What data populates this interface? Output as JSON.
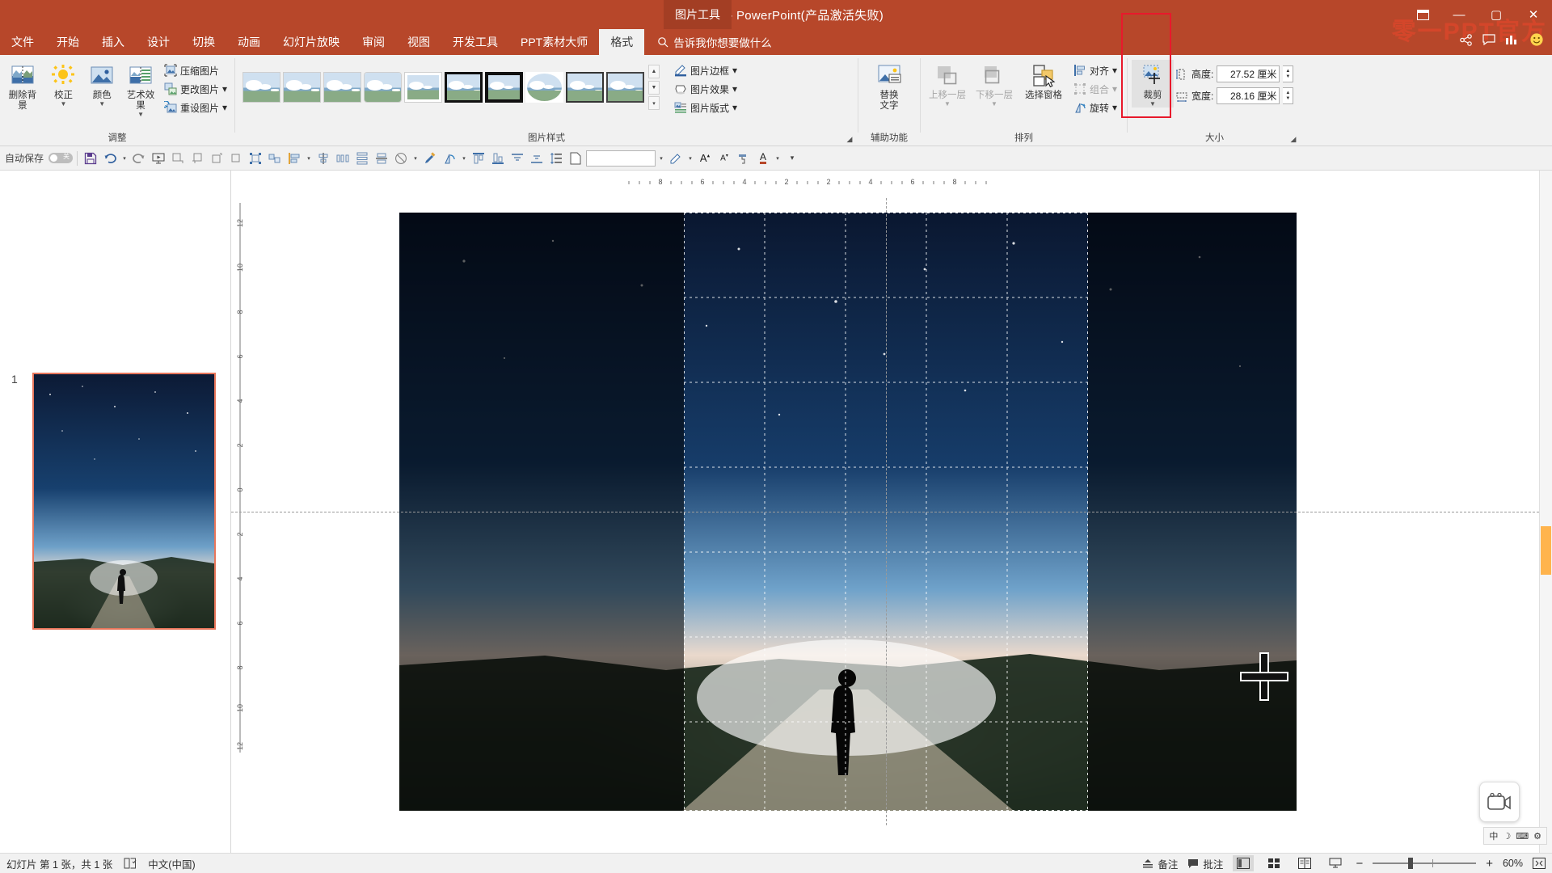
{
  "titlebar": {
    "title": "演示文稿1  -  PowerPoint(产品激活失败)",
    "context_tab": "图片工具",
    "ribbon_display_icon": "ribbon-display-icon",
    "minimize": "—",
    "maximize": "▢",
    "close": "✕"
  },
  "tabs": [
    {
      "label": "文件",
      "active": false
    },
    {
      "label": "开始",
      "active": false
    },
    {
      "label": "插入",
      "active": false
    },
    {
      "label": "设计",
      "active": false
    },
    {
      "label": "切换",
      "active": false
    },
    {
      "label": "动画",
      "active": false
    },
    {
      "label": "幻灯片放映",
      "active": false
    },
    {
      "label": "审阅",
      "active": false
    },
    {
      "label": "视图",
      "active": false
    },
    {
      "label": "开发工具",
      "active": false
    },
    {
      "label": "PPT素材大师",
      "active": false
    },
    {
      "label": "格式",
      "active": true
    }
  ],
  "tellme": {
    "text": "告诉我你想要做什么",
    "icon": "search-icon"
  },
  "watermark": "零一PPT官方",
  "ribbon": {
    "groups": [
      {
        "title": "调整",
        "big_buttons": [
          {
            "label": "删除背景",
            "icon": "remove-background-icon",
            "caret": false
          },
          {
            "label": "校正",
            "icon": "corrections-icon",
            "caret": true
          },
          {
            "label": "颜色",
            "icon": "color-icon",
            "caret": true
          },
          {
            "label": "艺术效果",
            "icon": "artistic-effects-icon",
            "caret": true
          }
        ],
        "small_buttons": [
          {
            "label": "压缩图片",
            "icon": "compress-picture-icon"
          },
          {
            "label": "更改图片",
            "icon": "change-picture-icon",
            "caret": true
          },
          {
            "label": "重设图片",
            "icon": "reset-picture-icon",
            "caret": true
          }
        ]
      },
      {
        "title": "图片样式",
        "styles_count": 10,
        "selected_index": 5,
        "scroll_up": "▲",
        "scroll_down": "▼",
        "scroll_more": "▾",
        "side_buttons": [
          {
            "label": "图片边框",
            "icon": "picture-border-icon"
          },
          {
            "label": "图片效果",
            "icon": "picture-effects-icon"
          },
          {
            "label": "图片版式",
            "icon": "picture-layout-icon"
          }
        ]
      },
      {
        "title": "辅助功能",
        "big_buttons": [
          {
            "label": "替换\n文字",
            "icon": "alt-text-icon"
          }
        ]
      },
      {
        "title": "排列",
        "big_buttons": [
          {
            "label": "上移一层",
            "icon": "bring-forward-icon",
            "caret": true,
            "disabled": true
          },
          {
            "label": "下移一层",
            "icon": "send-backward-icon",
            "caret": true,
            "disabled": true
          },
          {
            "label": "选择窗格",
            "icon": "selection-pane-icon",
            "caret": false
          }
        ],
        "small_buttons": [
          {
            "label": "对齐",
            "icon": "align-icon",
            "caret": true,
            "disabled": false
          },
          {
            "label": "组合",
            "icon": "group-icon",
            "caret": true,
            "disabled": true
          },
          {
            "label": "旋转",
            "icon": "rotate-icon",
            "caret": true,
            "disabled": false
          }
        ]
      },
      {
        "title": "大小",
        "crop": {
          "label": "裁剪",
          "icon": "crop-icon",
          "caret": true,
          "highlighted": true
        },
        "fields": [
          {
            "label": "高度:",
            "value": "27.52 厘米",
            "icon": "height-icon"
          },
          {
            "label": "宽度:",
            "value": "28.16 厘米",
            "icon": "width-icon"
          }
        ]
      }
    ]
  },
  "qat": {
    "autosave_label": "自动保存",
    "autosave_state": "关",
    "buttons": [
      {
        "icon": "save-icon"
      },
      {
        "icon": "undo-icon",
        "caret": true
      },
      {
        "icon": "redo-icon"
      },
      {
        "icon": "start-slideshow-icon"
      },
      {
        "icon": "shape-1-icon"
      },
      {
        "icon": "shape-2-icon"
      },
      {
        "icon": "shape-3-icon"
      },
      {
        "icon": "shape-4-icon"
      },
      {
        "icon": "group-objects-icon"
      },
      {
        "icon": "ungroup-objects-icon"
      },
      {
        "icon": "align-left-icon",
        "caret": true
      },
      {
        "icon": "align-center-h-icon"
      },
      {
        "icon": "distribute-h-icon"
      },
      {
        "icon": "distribute-v-icon"
      },
      {
        "icon": "align-middle-icon"
      },
      {
        "icon": "shape-fill-icon",
        "caret": true
      },
      {
        "icon": "eyedropper-icon"
      },
      {
        "icon": "rotate-left-icon",
        "caret": true
      },
      {
        "icon": "align-top-icon"
      },
      {
        "icon": "align-bottom-icon"
      },
      {
        "icon": "distribute-top-icon"
      },
      {
        "icon": "distribute-bottom-icon"
      },
      {
        "icon": "line-spacing-icon"
      },
      {
        "icon": "new-slide-icon"
      }
    ],
    "combo_value": "",
    "right_buttons": [
      {
        "icon": "shape-outline-icon",
        "caret": true
      },
      {
        "icon": "increase-font-size-icon"
      },
      {
        "icon": "decrease-font-size-icon"
      },
      {
        "icon": "format-painter-icon"
      },
      {
        "icon": "font-color-icon",
        "caret": true
      },
      {
        "icon": "qat-more-icon"
      }
    ]
  },
  "slides_pane": {
    "slide_number": "1"
  },
  "ruler": {
    "horizontal_ticks": [
      "8",
      "6",
      "4",
      "2",
      "2",
      "4",
      "6",
      "8"
    ],
    "vertical_ticks": [
      "12",
      "10",
      "8",
      "6",
      "4",
      "2",
      "0",
      "2",
      "4",
      "6",
      "8",
      "10",
      "12"
    ]
  },
  "statusbar": {
    "slide_info": "幻灯片 第 1 张，共 1 张",
    "language": "中文(中国)",
    "accessibility_icon": "accessibility-icon",
    "notes_label": "备注",
    "notes_icon": "notes-icon",
    "comments_label": "批注",
    "comments_icon": "comments-icon",
    "views": [
      {
        "icon": "normal-view-icon",
        "active": true
      },
      {
        "icon": "slide-sorter-icon",
        "active": false
      },
      {
        "icon": "reading-view-icon",
        "active": false
      },
      {
        "icon": "slideshow-view-icon",
        "active": false
      }
    ],
    "zoom_out": "−",
    "zoom_in": "+",
    "zoom_value": "60%",
    "fit_icon": "fit-slide-icon"
  },
  "ime_tray": {
    "items": [
      "中",
      "moon-icon",
      "keyboard-icon",
      "settings-icon"
    ]
  },
  "floating": {
    "icon": "video-play-icon"
  },
  "colors": {
    "accent": "#b7472a",
    "accent_dark": "#a33e24",
    "highlight_red": "#e8192c",
    "selection_orange": "#e8765b",
    "scroll_orange": "#ffb44d"
  }
}
